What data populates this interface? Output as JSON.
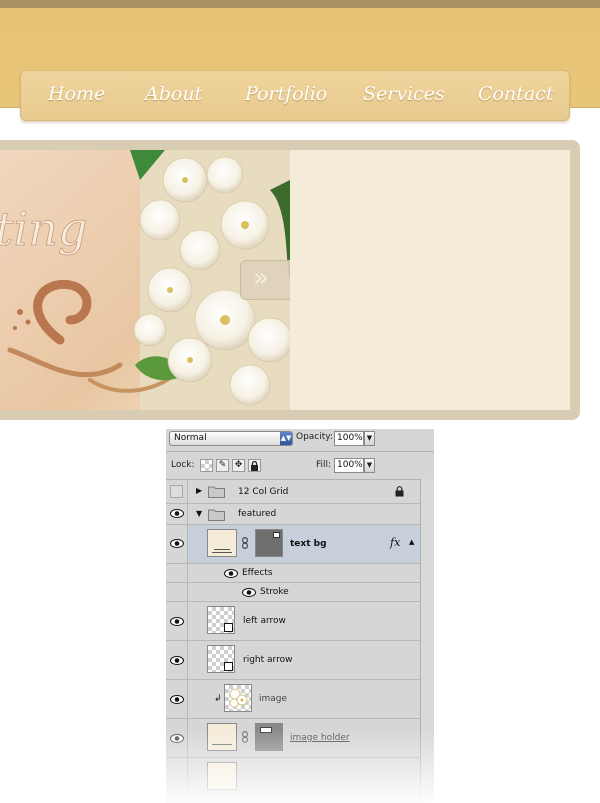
{
  "website": {
    "nav": {
      "items": [
        {
          "label": "Home"
        },
        {
          "label": "About"
        },
        {
          "label": "Portfolio"
        },
        {
          "label": "Services"
        },
        {
          "label": "Contact"
        }
      ]
    },
    "slider": {
      "script_text": "ting",
      "arrow_glyph": "»"
    }
  },
  "layers_panel": {
    "blend_mode": "Normal",
    "opacity_label": "Opacity:",
    "opacity_value": "100%",
    "lock_label": "Lock:",
    "fill_label": "Fill:",
    "fill_value": "100%",
    "layers": [
      {
        "name": "12 Col Grid",
        "type": "group",
        "expanded": false,
        "visible": false,
        "locked": true
      },
      {
        "name": "featured",
        "type": "group",
        "expanded": true,
        "visible": true
      },
      {
        "name": "text bg",
        "type": "layer",
        "visible": true,
        "selected": true,
        "has_fx": true,
        "fx_label": "fx"
      },
      {
        "name": "Effects",
        "type": "effects-header",
        "visible": true
      },
      {
        "name": "Stroke",
        "type": "effect",
        "visible": true
      },
      {
        "name": "left arrow",
        "type": "smart-object",
        "visible": true
      },
      {
        "name": "right arrow",
        "type": "smart-object",
        "visible": true
      },
      {
        "name": "image",
        "type": "clipped-layer",
        "visible": true
      },
      {
        "name": "image holder",
        "type": "layer",
        "visible": true
      }
    ]
  },
  "colors": {
    "header": "#e7c277",
    "nav": "#edd39c",
    "slider_frame": "#d8ccb3",
    "text_panel": "#f4ebd9",
    "panel_bg": "#d6d6d6",
    "selected_row": "#c7cfdb"
  }
}
